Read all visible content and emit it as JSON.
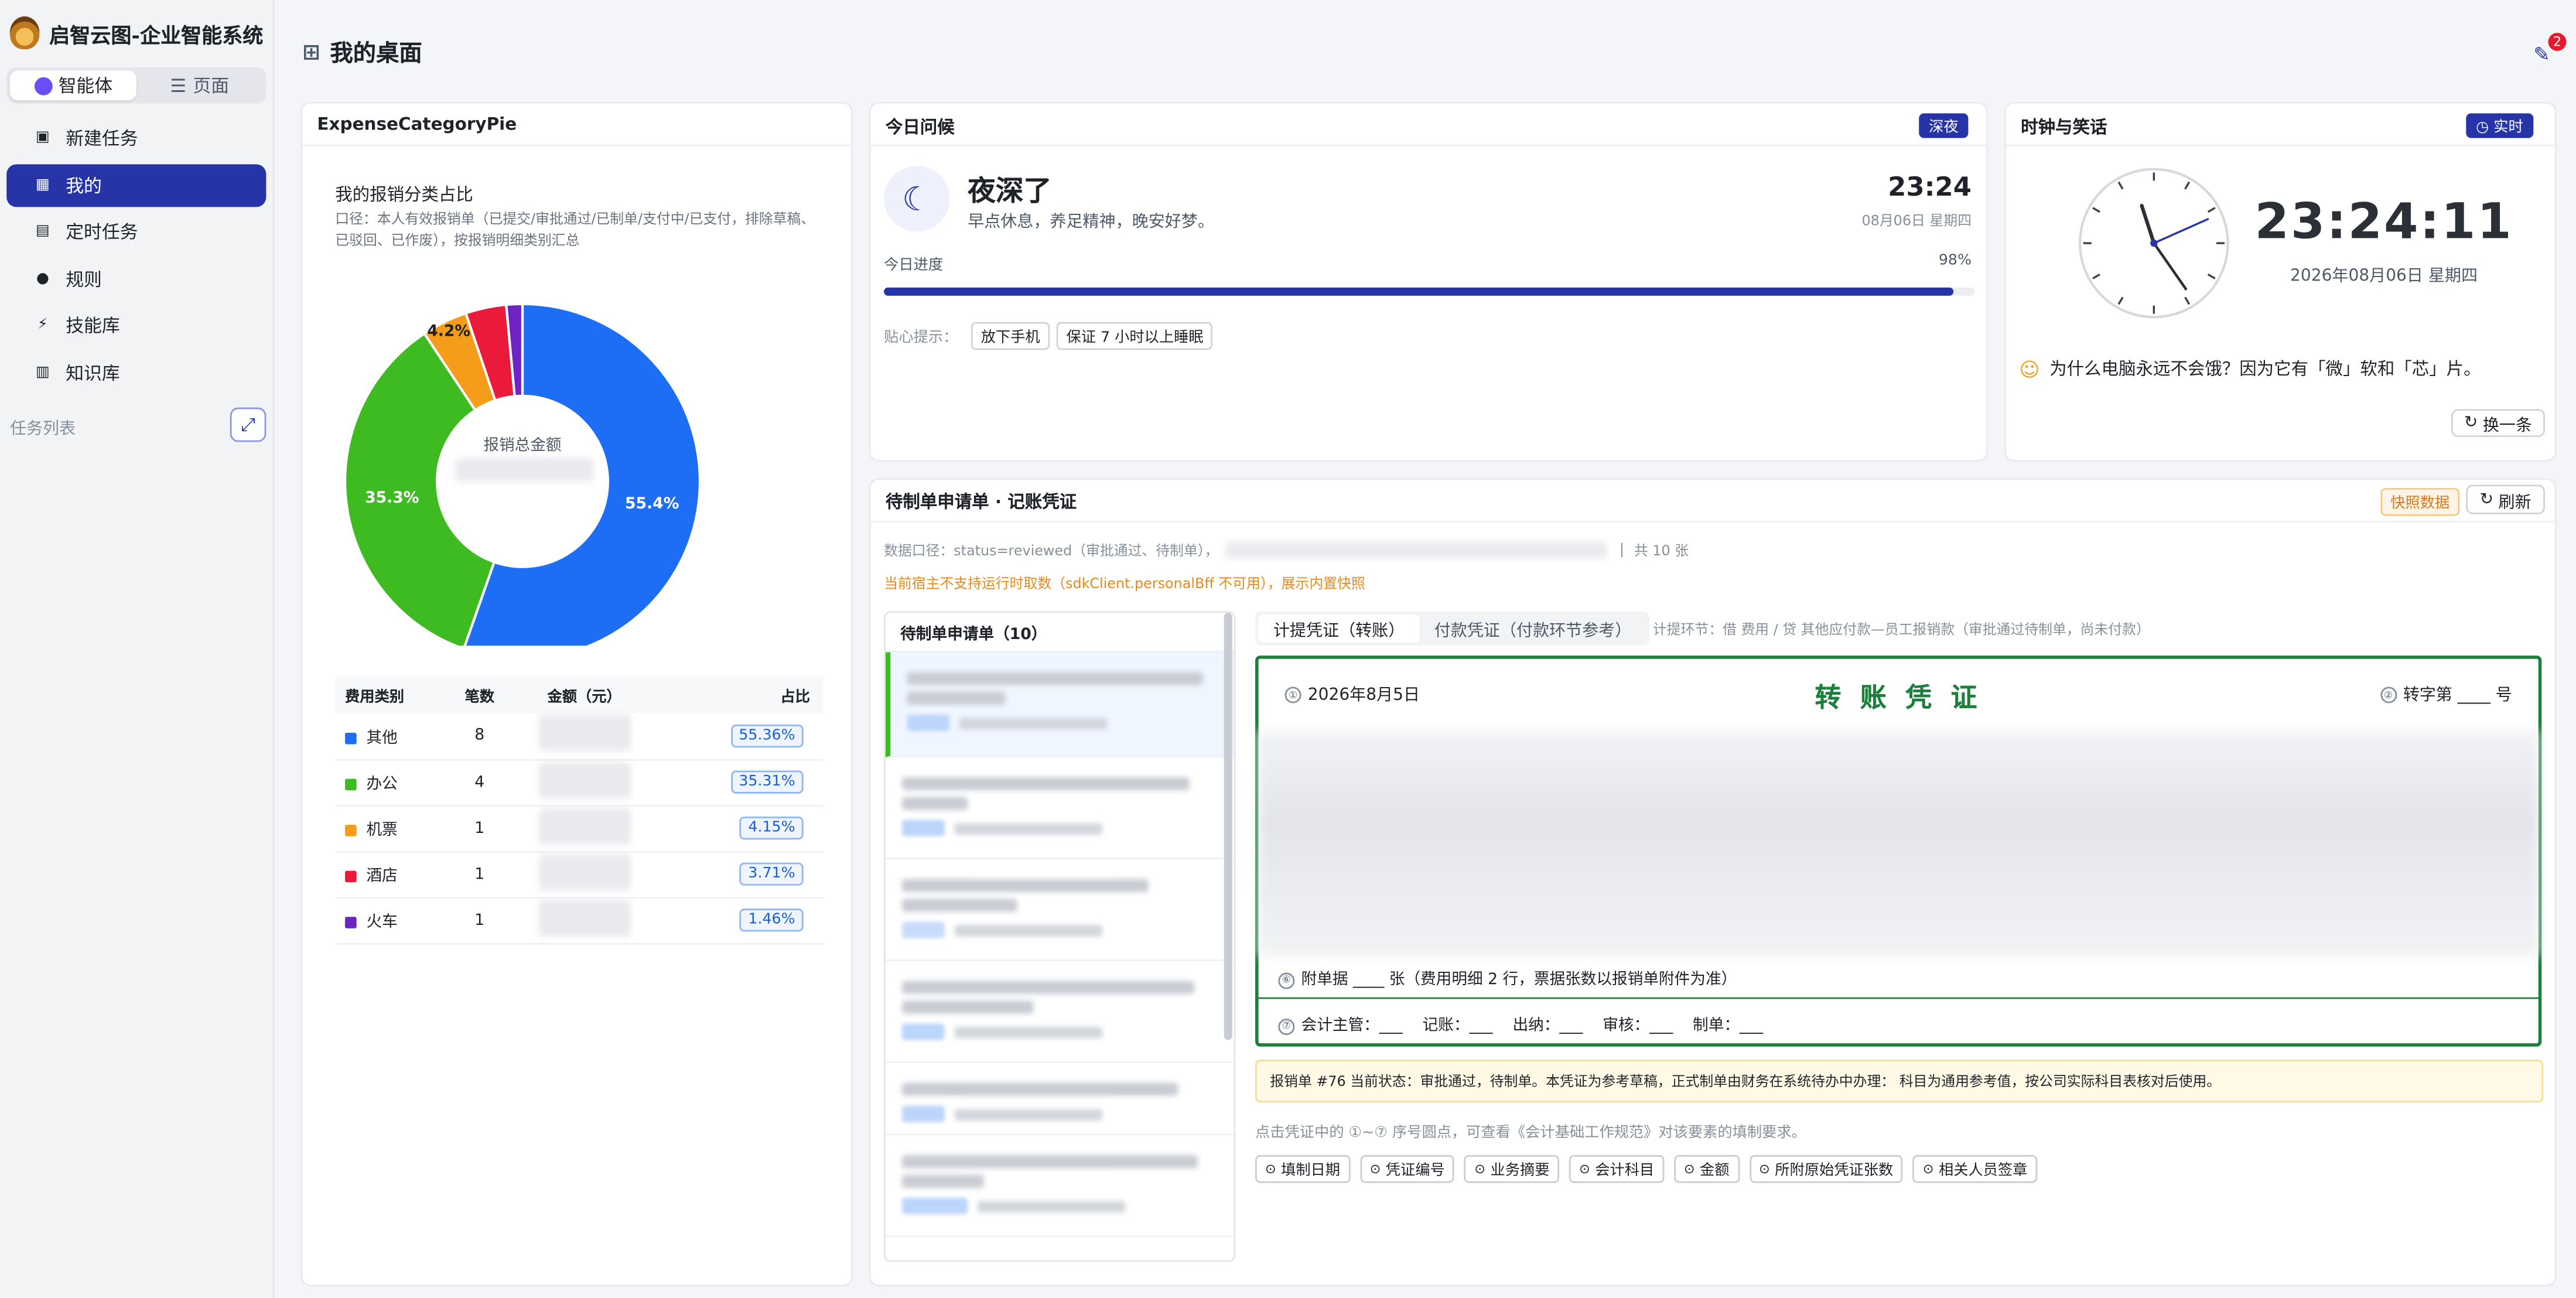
{
  "app": {
    "title": "启智云图-企业智能系统"
  },
  "sidebar": {
    "segments": [
      "智能体",
      "页面"
    ],
    "items": [
      {
        "label": "新建任务",
        "icon": "new-task-icon"
      },
      {
        "label": "我的",
        "icon": "grid-icon"
      },
      {
        "label": "定时任务",
        "icon": "calendar-icon"
      },
      {
        "label": "规则",
        "icon": "rule-icon"
      },
      {
        "label": "技能库",
        "icon": "bolt-icon"
      },
      {
        "label": "知识库",
        "icon": "book-icon"
      }
    ],
    "task_list_label": "任务列表"
  },
  "header": {
    "title": "我的桌面",
    "notification_count": "2"
  },
  "expense_card": {
    "title": "ExpenseCategoryPie",
    "subtitle": "我的报销分类占比",
    "desc": "口径：本人有效报销单（已提交/审批通过/已制单/支付中/已支付，排除草稿、已驳回、已作废），按报销明细类别汇总",
    "center_label": "报销总金额",
    "table_headers": [
      "费用类别",
      "笔数",
      "金额（元）",
      "占比"
    ],
    "rows": [
      {
        "name": "其他",
        "count": "8",
        "pct": "55.36%",
        "color": "#1e6ef5"
      },
      {
        "name": "办公",
        "count": "4",
        "pct": "35.31%",
        "color": "#3fbb22"
      },
      {
        "name": "机票",
        "count": "1",
        "pct": "4.15%",
        "color": "#f59c1a"
      },
      {
        "name": "酒店",
        "count": "1",
        "pct": "3.71%",
        "color": "#ec1a3a"
      },
      {
        "name": "火车",
        "count": "1",
        "pct": "1.46%",
        "color": "#6e24c4"
      }
    ]
  },
  "chart_data": {
    "type": "pie",
    "categories": [
      "其他",
      "办公",
      "机票",
      "酒店",
      "火车"
    ],
    "values": [
      55.36,
      35.31,
      4.15,
      3.71,
      1.46
    ],
    "labels": [
      "55.4%",
      "35.3%",
      "4.2%",
      "",
      ""
    ],
    "colors": [
      "#1e6ef5",
      "#3fbb22",
      "#f59c1a",
      "#ec1a3a",
      "#6e24c4"
    ],
    "title": "我的报销分类占比"
  },
  "greeting": {
    "title": "今日问候",
    "badge": "深夜",
    "headline": "夜深了",
    "message": "早点休息，养足精神，晚安好梦。",
    "time": "23:24",
    "date": "08月06日 星期四",
    "progress_label": "今日进度",
    "progress_text": "98%",
    "progress": 0.98,
    "tips_label": "贴心提示：",
    "tips": [
      "放下手机",
      "保证 7 小时以上睡眠"
    ]
  },
  "clock": {
    "title": "时钟与笑话",
    "badge": "实时",
    "time": "23:24:11",
    "date": "2026年08月06日 星期四",
    "hour": 23,
    "minute": 24,
    "second": 11,
    "joke": "为什么电脑永远不会饿？因为它有「微」软和「芯」片。",
    "refresh_label": "换一条"
  },
  "pending": {
    "title": "待制单申请单 · 记账凭证",
    "snapshot_badge": "快照数据",
    "refresh_label": "刷新",
    "source_line": "数据口径：status=reviewed（审批通过、待制单），",
    "total_text": "共 10 张",
    "warning": "当前宿主不支持运行时取数（sdkClient.personalBff 不可用），展示内置快照",
    "list_title": "待制单申请单（10）",
    "tabs": [
      "计提凭证（转账）",
      "付款凭证（付款环节参考）"
    ],
    "tab_note": "计提环节：借 费用 / 贷 其他应付款—员工报销款（审批通过待制单，尚未付款）"
  },
  "voucher": {
    "date": "2026年8月5日",
    "title": "转 账 凭 证",
    "number": "转字第 ____ 号",
    "attachment": "附单据 ____ 张（费用明细 2 行，票据张数以报销单附件为准）",
    "signers": "会计主管：___    记账：___    出纳：___    审核：___    制单：___",
    "status_note": "报销单 #76 当前状态：审批通过，待制单。本凭证为参考草稿，正式制单由财务在系统待办中办理： 科目为通用参考值，按公司实际科目表核对后使用。",
    "help_text": "点击凭证中的 ①~⑦ 序号圆点，可查看《会计基础工作规范》对该要素的填制要求。",
    "hint_tags": [
      "填制日期",
      "凭证编号",
      "业务摘要",
      "会计科目",
      "金额",
      "所附原始凭证张数",
      "相关人员签章"
    ]
  }
}
